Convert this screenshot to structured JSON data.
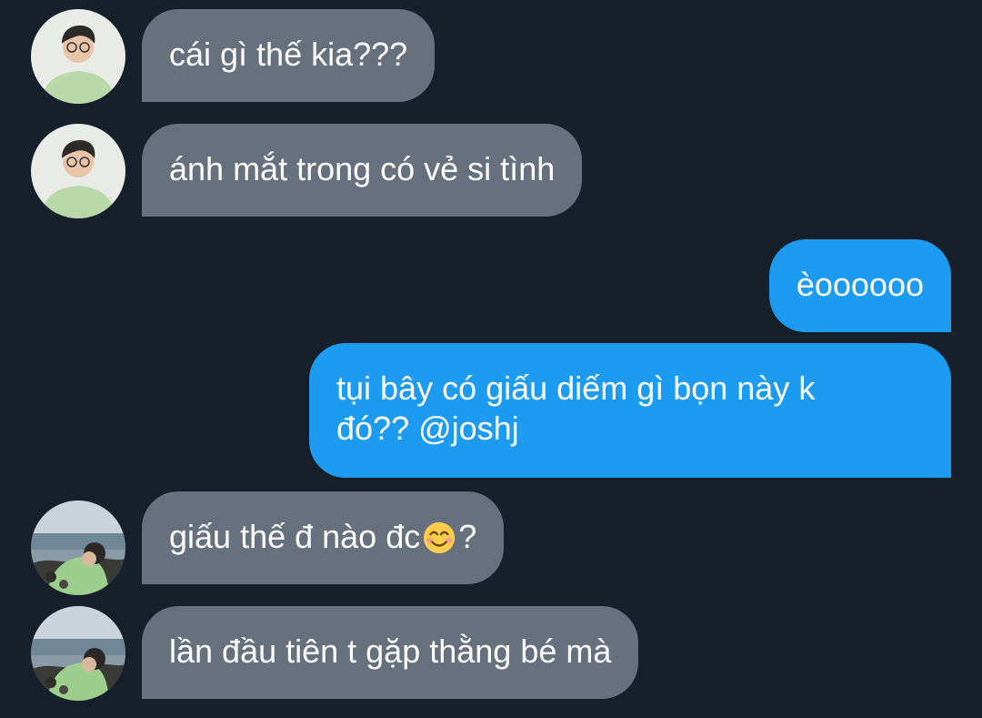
{
  "theme": {
    "background": "#15202b",
    "incoming_bubble": "#66717d",
    "outgoing_bubble": "#1d9bf0",
    "text": "#ffffff"
  },
  "avatars": {
    "user_a": "avatar-man-glasses-green-shirt",
    "user_b": "avatar-man-at-beach-rocks"
  },
  "messages": [
    {
      "direction": "incoming",
      "sender": "user_a",
      "text": "cái gì thế kia???"
    },
    {
      "direction": "incoming",
      "sender": "user_a",
      "text": "ánh mắt trong có vẻ si tình"
    },
    {
      "direction": "outgoing",
      "text": "èoooooo"
    },
    {
      "direction": "outgoing",
      "text_line1": "tụi bây có giấu diếm gì bọn này k",
      "text_line2": "đó?? @joshj"
    },
    {
      "direction": "incoming",
      "sender": "user_b",
      "text_before_emoji": "giấu thế đ nào đc",
      "emoji": "smiling-face-with-smiling-eyes-emoji",
      "text_after_emoji": "?"
    },
    {
      "direction": "incoming",
      "sender": "user_b",
      "text": "lần đầu tiên t gặp thằng bé mà"
    }
  ]
}
